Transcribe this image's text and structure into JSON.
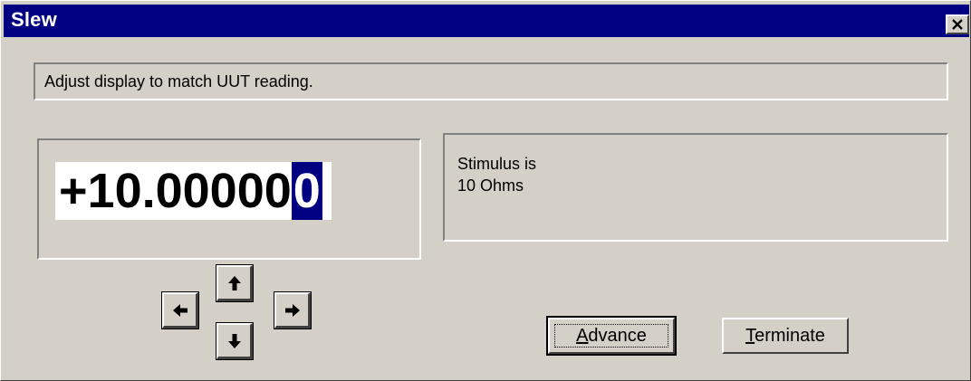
{
  "window": {
    "title": "Slew",
    "close_label": "×"
  },
  "status": {
    "text": "Adjust display to match UUT reading."
  },
  "display": {
    "value_prefix": "+10.00000",
    "value_cursor_digit": "0"
  },
  "info": {
    "line1": "Stimulus is",
    "line2": "10 Ohms"
  },
  "arrows": {
    "up": "up-arrow-icon",
    "down": "down-arrow-icon",
    "left": "left-arrow-icon",
    "right": "right-arrow-icon"
  },
  "buttons": {
    "advance": {
      "mnemonic": "A",
      "rest": "dvance"
    },
    "terminate": {
      "mnemonic": "T",
      "rest": "erminate"
    }
  },
  "colors": {
    "title_bar": "#000080",
    "face": "#d4d0c8",
    "cursor_highlight": "#000080"
  }
}
